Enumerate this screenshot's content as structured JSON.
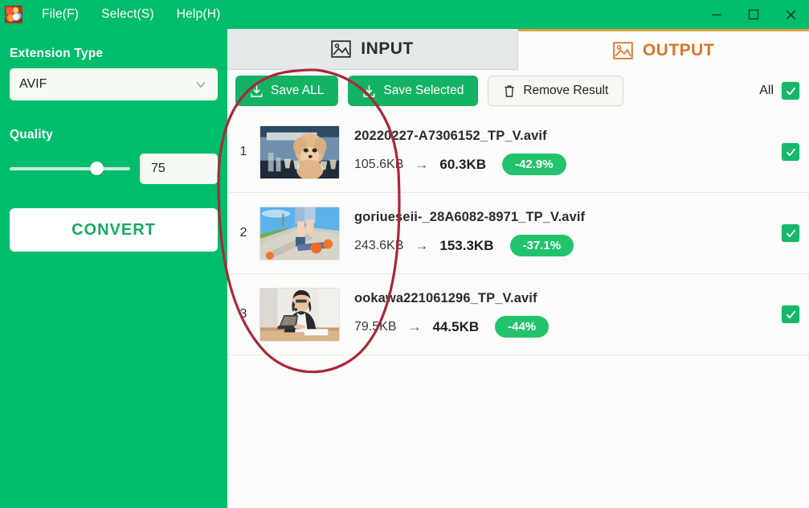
{
  "window": {
    "menu": [
      {
        "label": "File(F)",
        "name": "menu-file"
      },
      {
        "label": "Select(S)",
        "name": "menu-select"
      },
      {
        "label": "Help(H)",
        "name": "menu-help"
      }
    ],
    "controls": {
      "minimize": "—",
      "maximize": "□",
      "close": "✕"
    },
    "app_icon": "app-logo-icon"
  },
  "sidebar": {
    "extension_label": "Extension Type",
    "extension_value": "AVIF",
    "extension_options": [
      "AVIF"
    ],
    "quality_label": "Quality",
    "quality_value": "75",
    "quality_slider_percent": 75,
    "convert_label": "CONVERT"
  },
  "tabs": [
    {
      "label": "INPUT",
      "icon": "image-icon",
      "active": false
    },
    {
      "label": "OUTPUT",
      "icon": "image-icon",
      "active": true
    }
  ],
  "toolbar": {
    "save_all": "Save ALL",
    "save_selected": "Save Selected",
    "remove_result": "Remove Result",
    "all_label": "All",
    "all_checked": true
  },
  "results": [
    {
      "index": "1",
      "filename": "20220227-A7306152_TP_V.avif",
      "size_before": "105.6KB",
      "arrow": "→",
      "size_after": "60.3KB",
      "reduction": "-42.9%",
      "checked": true,
      "thumb": "dog-thumbnail"
    },
    {
      "index": "2",
      "filename": "goriueseii-_28A6082-8971_TP_V.avif",
      "size_before": "243.6KB",
      "arrow": "→",
      "size_after": "153.3KB",
      "reduction": "-37.1%",
      "checked": true,
      "thumb": "skateboard-thumbnail"
    },
    {
      "index": "3",
      "filename": "ookawa221061296_TP_V.avif",
      "size_before": "79.5KB",
      "arrow": "→",
      "size_after": "44.5KB",
      "reduction": "-44%",
      "checked": true,
      "thumb": "person-laptop-thumbnail"
    }
  ],
  "annotation": {
    "shape": "hand-drawn-ellipse",
    "color": "#a8283c"
  },
  "colors": {
    "brand_green": "#00bd6b",
    "button_green": "#14b363",
    "badge_green": "#23c36d",
    "output_orange": "#d9762b",
    "tab_border_orange": "#e0a44a",
    "annotation_red": "#a8283c"
  }
}
